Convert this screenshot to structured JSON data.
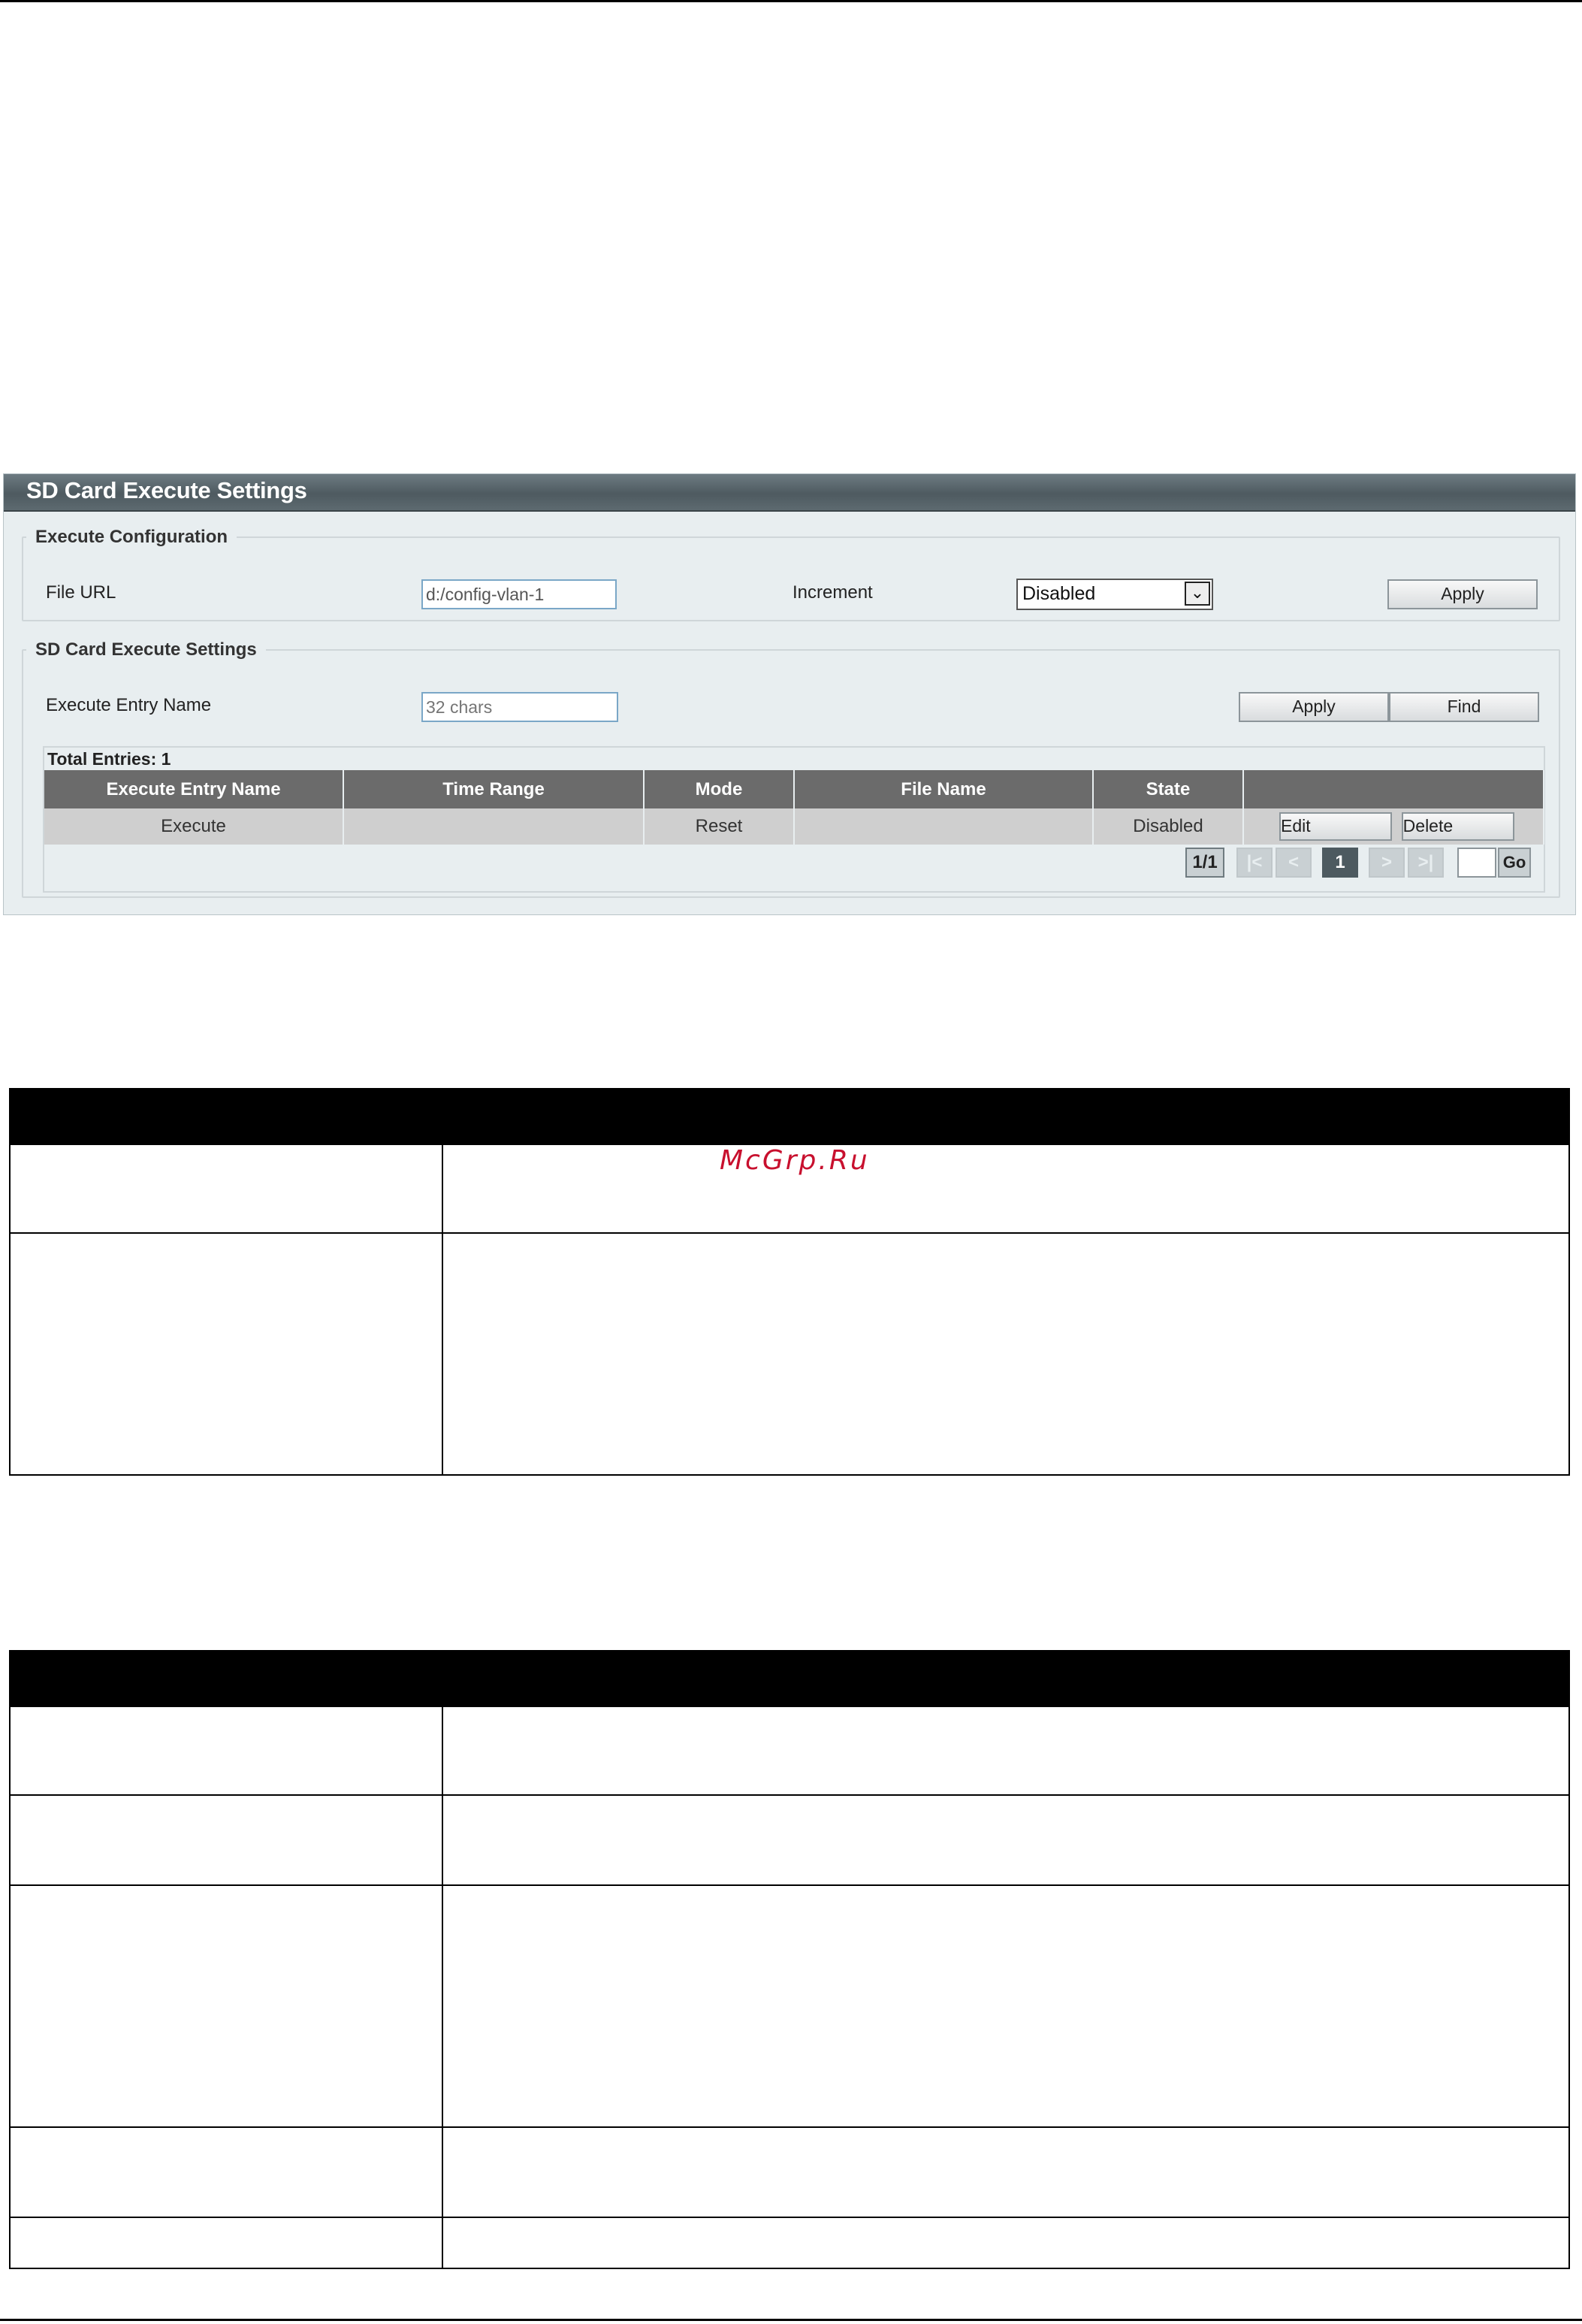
{
  "panel": {
    "title": "SD Card Execute Settings",
    "execute_configuration": {
      "legend": "Execute Configuration",
      "file_url_label": "File URL",
      "file_url_value": "d:/config-vlan-1",
      "increment_label": "Increment",
      "increment_value": "Disabled",
      "apply_label": "Apply"
    },
    "execute_settings": {
      "legend": "SD Card Execute Settings",
      "entry_name_label": "Execute Entry Name",
      "entry_name_placeholder": "32 chars",
      "apply_label": "Apply",
      "find_label": "Find"
    },
    "table": {
      "total_entries": "Total Entries: 1",
      "columns": [
        "Execute Entry Name",
        "Time Range",
        "Mode",
        "File Name",
        "State",
        ""
      ],
      "rows": [
        {
          "execute_entry_name": "Execute",
          "time_range": "",
          "mode": "Reset",
          "file_name": "",
          "state": "Disabled",
          "edit_label": "Edit",
          "delete_label": "Delete"
        }
      ]
    },
    "pagination": {
      "page_info": "1/1",
      "first": "|<",
      "prev": "<",
      "current": "1",
      "next": ">",
      "last": ">|",
      "go_label": "Go"
    }
  },
  "watermark": "McGrp.Ru"
}
